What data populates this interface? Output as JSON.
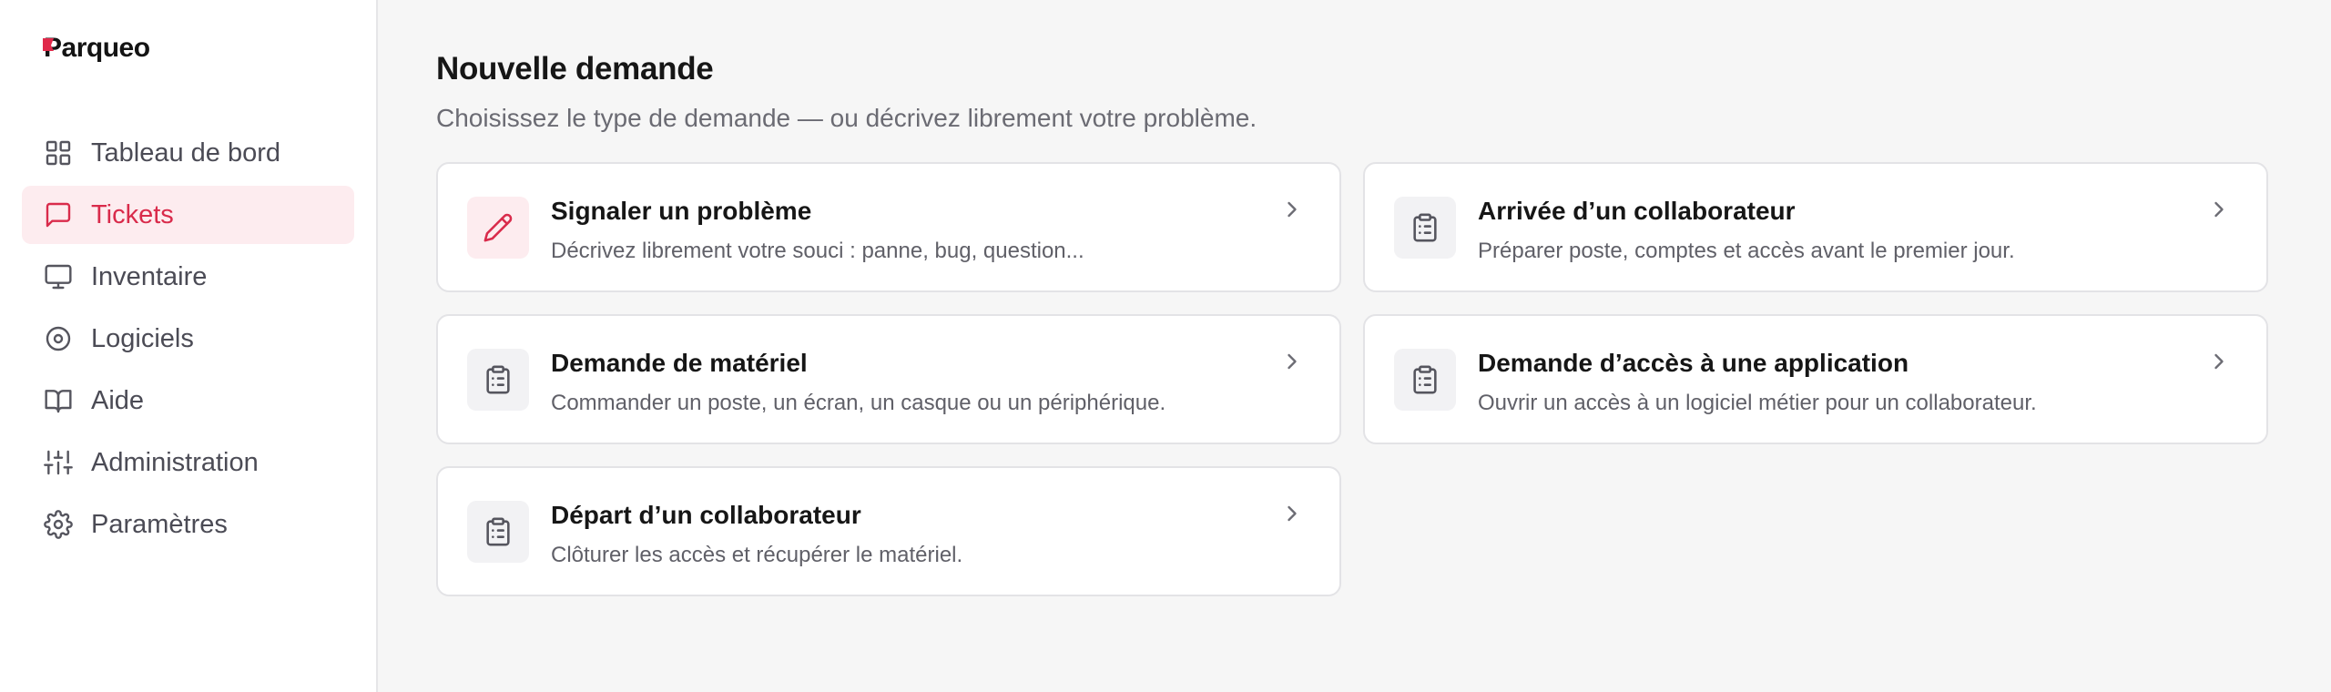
{
  "app": {
    "brand": "Parqueo"
  },
  "sidebar": {
    "items": [
      {
        "label": "Tableau de bord",
        "icon": "dashboard-grid-icon",
        "active": false
      },
      {
        "label": "Tickets",
        "icon": "message-square-icon",
        "active": true
      },
      {
        "label": "Inventaire",
        "icon": "monitor-icon",
        "active": false
      },
      {
        "label": "Logiciels",
        "icon": "disc-icon",
        "active": false
      },
      {
        "label": "Aide",
        "icon": "book-open-icon",
        "active": false
      },
      {
        "label": "Administration",
        "icon": "sliders-icon",
        "active": false
      },
      {
        "label": "Paramètres",
        "icon": "gear-icon",
        "active": false
      }
    ]
  },
  "main": {
    "title": "Nouvelle demande",
    "subtitle": "Choisissez le type de demande — ou décrivez librement votre problème.",
    "cards": [
      {
        "title": "Signaler un problème",
        "description": "Décrivez librement votre souci : panne, bug, question...",
        "icon": "pencil-icon"
      },
      {
        "title": "Arrivée d’un collaborateur",
        "description": "Préparer poste, comptes et accès avant le premier jour.",
        "icon": "clipboard-icon"
      },
      {
        "title": "Demande de matériel",
        "description": "Commander un poste, un écran, un casque ou un périphérique.",
        "icon": "clipboard-icon"
      },
      {
        "title": "Demande d’accès à une application",
        "description": "Ouvrir un accès à un logiciel métier pour un collaborateur.",
        "icon": "clipboard-icon"
      },
      {
        "title": "Départ d’un collaborateur",
        "description": "Clôturer les accès et récupérer le matériel.",
        "icon": "clipboard-icon"
      }
    ]
  },
  "colors": {
    "accent": "#d92b4b",
    "accent_bg": "#fdecef",
    "text_muted": "#6b6b73"
  }
}
